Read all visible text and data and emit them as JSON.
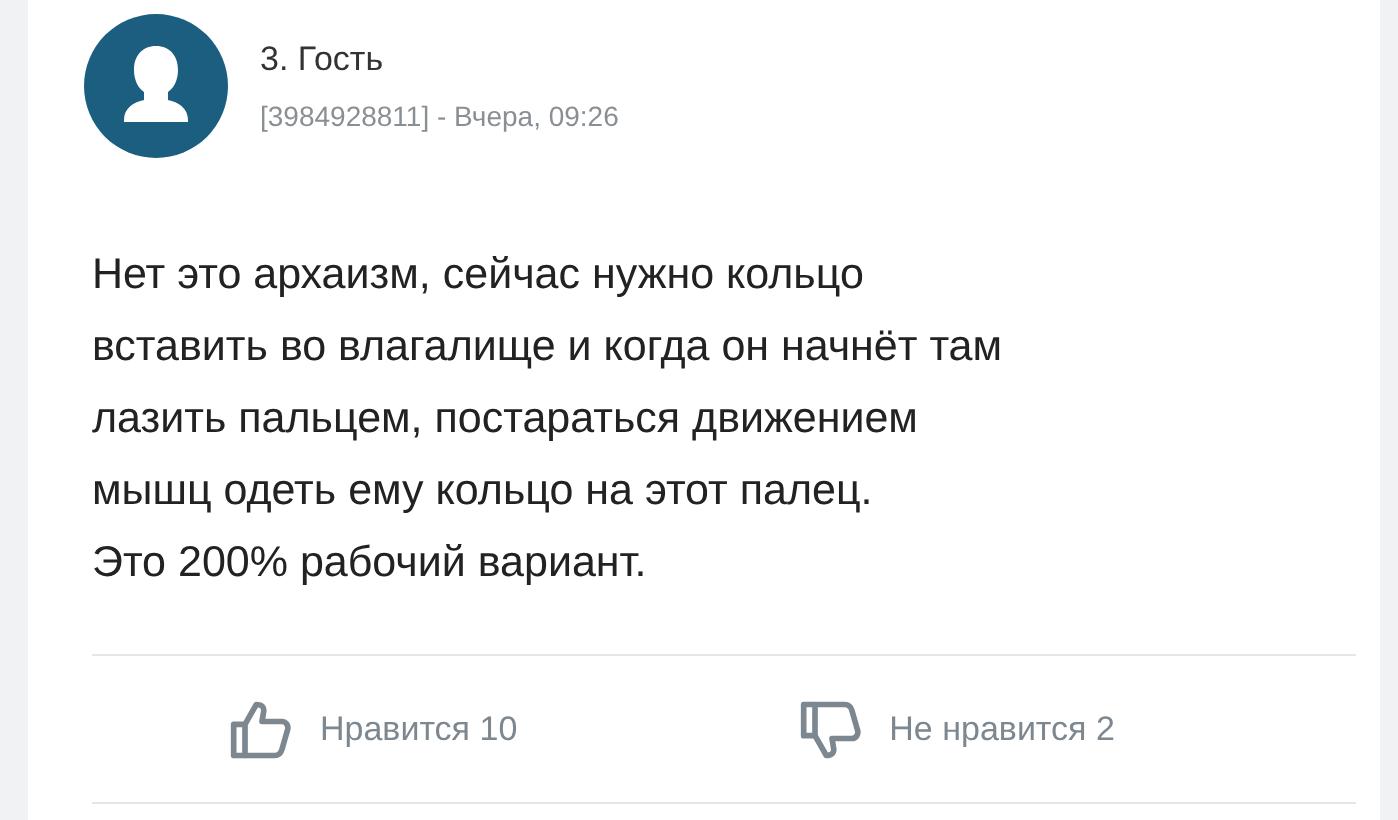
{
  "comment": {
    "author": "3. Гость",
    "meta": "[3984928811] - Вчера, 09:26",
    "text": "Нет это архаизм, сейчас нужно кольцо\nвставить во влагалище и когда он начнёт там\nлазить пальцем, постараться движением\nмышц одеть ему кольцо на этот палец.\nЭто 200% рабочий вариант.",
    "reactions": [
      {
        "kind": "like",
        "label": "Нравится 10"
      },
      {
        "kind": "dislike",
        "label": "Не нравится 2"
      }
    ]
  }
}
